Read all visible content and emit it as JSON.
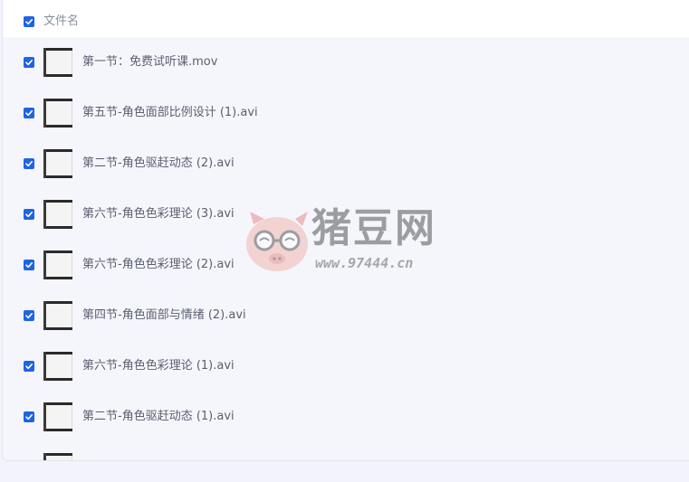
{
  "header": {
    "column_label": "文件名",
    "checked": true
  },
  "files": [
    {
      "name": "第一节：免费试听课.mov",
      "checked": true
    },
    {
      "name": "第五节-角色面部比例设计 (1).avi",
      "checked": true
    },
    {
      "name": "第二节-角色驱赶动态 (2).avi",
      "checked": true
    },
    {
      "name": "第六节-角色色彩理论 (3).avi",
      "checked": true
    },
    {
      "name": "第六节-角色色彩理论 (2).avi",
      "checked": true
    },
    {
      "name": "第四节-角色面部与情绪 (2).avi",
      "checked": true
    },
    {
      "name": "第六节-角色色彩理论 (1).avi",
      "checked": true
    },
    {
      "name": "第二节-角色驱赶动态 (1).avi",
      "checked": true
    },
    {
      "name": "",
      "checked": true
    }
  ],
  "watermark": {
    "brand": "猪豆网",
    "url": "www.97444.cn"
  },
  "colors": {
    "accent": "#1f63e6",
    "text": "#5b6070",
    "header_text": "#8a8f9c"
  }
}
